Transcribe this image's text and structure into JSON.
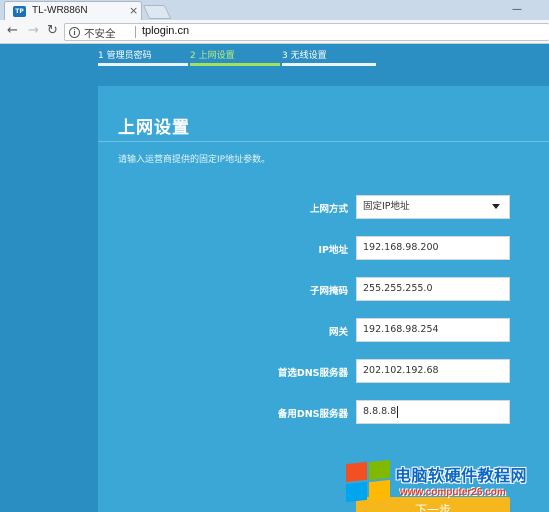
{
  "browser": {
    "tab_title": "TL-WR886N",
    "tab_favicon_text": "TP",
    "tab_close": "×",
    "minimize": "—",
    "security_label": "不安全",
    "url": "tplogin.cn",
    "icons": [
      "back-arrow-icon",
      "forward-arrow-icon",
      "reload-icon",
      "info-icon",
      "close-icon",
      "minimize-icon"
    ]
  },
  "steps": [
    {
      "label": "1 管理员密码",
      "active": false
    },
    {
      "label": "2 上网设置",
      "active": true
    },
    {
      "label": "3 无线设置",
      "active": false
    }
  ],
  "panel": {
    "title": "上网设置",
    "description": "请输入运营商提供的固定IP地址参数。"
  },
  "form": {
    "connection_type": {
      "label": "上网方式",
      "value": "固定IP地址"
    },
    "ip_address": {
      "label": "IP地址",
      "value": "192.168.98.200"
    },
    "subnet_mask": {
      "label": "子网掩码",
      "value": "255.255.255.0"
    },
    "gateway": {
      "label": "网关",
      "value": "192.168.98.254"
    },
    "primary_dns": {
      "label": "首选DNS服务器",
      "value": "202.102.192.68"
    },
    "secondary_dns": {
      "label": "备用DNS服务器",
      "value": "8.8.8.8"
    }
  },
  "next_button": {
    "label": "下一步"
  },
  "watermark": {
    "title": "电脑软硬件教程网",
    "url": "www.computer26.com"
  },
  "colors": {
    "page_bg": "#2c8fc3",
    "panel_bg": "#3aa7d6",
    "active_step": "#a5e05a",
    "button": "#f5b71c"
  }
}
